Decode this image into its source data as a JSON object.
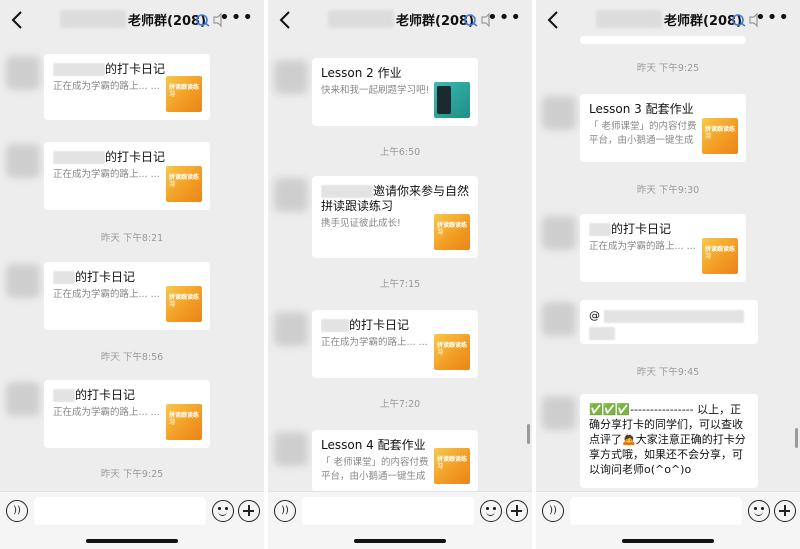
{
  "chat_title": "老师群(208)",
  "panels": [
    {
      "cards": [
        {
          "title": "的打卡日记",
          "desc": "正在成为学霸的路上... ...",
          "thumb": "拼读跟读练习"
        },
        {
          "title": "的打卡日记",
          "desc": "正在成为学霸的路上... ...",
          "thumb": "拼读跟读练习"
        },
        {
          "title": "的打卡日记",
          "desc": "正在成为学霸的路上... ...",
          "thumb": "拼读跟读练习"
        },
        {
          "title": "的打卡日记",
          "desc": "正在成为学霸的路上... ...",
          "thumb": "拼读跟读练习"
        }
      ],
      "times": [
        "昨天 下午8:21",
        "昨天 下午8:56",
        "昨天 下午9:25"
      ]
    },
    {
      "cards": [
        {
          "title": "Lesson 2 作业",
          "desc": "快来和我一起刷题学习吧!"
        },
        {
          "title": "邀请你来参与自然拼读跟读练习",
          "desc": "携手见证彼此成长!",
          "thumb": "拼读跟读练习"
        },
        {
          "title": "的打卡日记",
          "desc": "正在成为学霸的路上... ...",
          "thumb": "拼读跟读练习"
        },
        {
          "title": "Lesson 4 配套作业",
          "desc": "「 老师课堂」的内容付费平台，由小鹅通一键生成",
          "thumb": "拼读跟读练习"
        }
      ],
      "times": [
        "上午6:50",
        "上午7:15",
        "上午7:20"
      ]
    },
    {
      "cards": [
        {
          "title": "Lesson 3 配套作业",
          "desc": "「 老师课堂」的内容付费平台，由小鹅通一键生成",
          "thumb": "拼读跟读练习"
        },
        {
          "title": "的打卡日记",
          "desc": "正在成为学霸的路上... ...",
          "thumb": "拼读跟读练习"
        }
      ],
      "mention": "@",
      "message": "✅✅✅---------------- 以上，正确分享打卡的同学们，可以查收点评了🙇大家注意正确的打卡分享方式哦，如果还不会分享，可以询问老师o(^o^)o",
      "times": [
        "昨天 下午9:25",
        "昨天 下午9:30",
        "昨天 下午9:45"
      ]
    }
  ],
  "icons": {
    "back": "chevron-left-icon",
    "more": "more-dots-icon",
    "voice": "voice-icon",
    "emoji": "emoji-icon",
    "plus": "plus-icon"
  },
  "colors": {
    "chat_bg": "#ededed",
    "card_bg": "#ffffff",
    "thumb_orange": "#f29a22",
    "thumb_green": "#1c8f86",
    "time_text": "#9a9a9a"
  }
}
